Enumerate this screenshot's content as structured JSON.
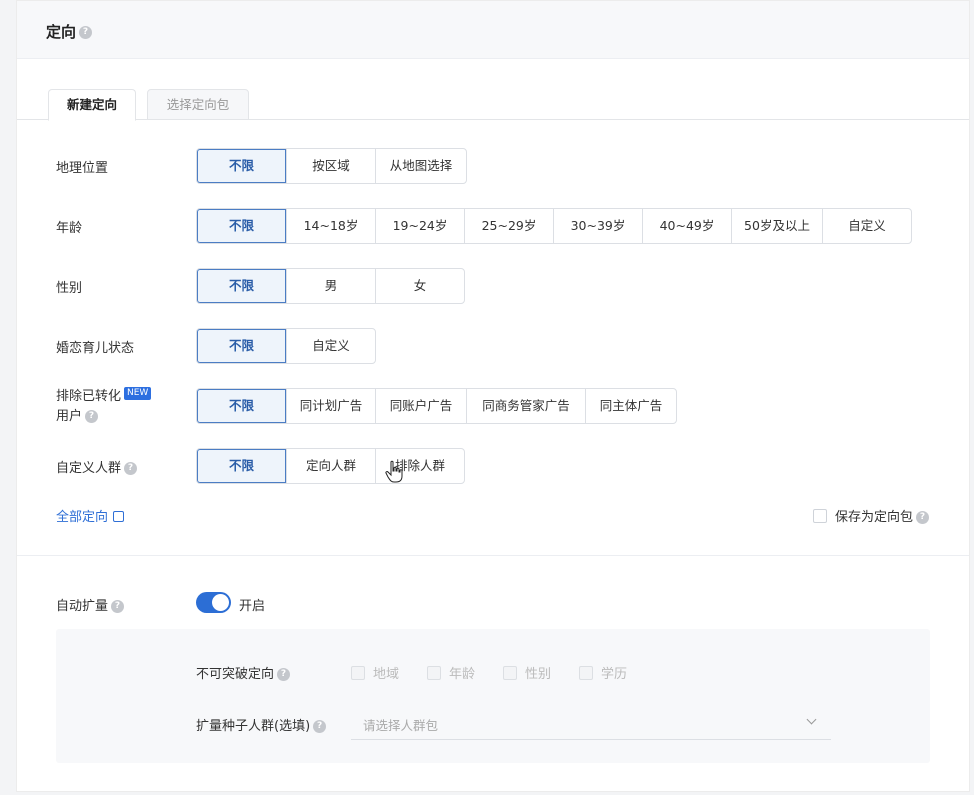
{
  "header": {
    "title": "定向"
  },
  "tabs": [
    {
      "label": "新建定向",
      "active": true
    },
    {
      "label": "选择定向包",
      "active": false
    }
  ],
  "rows": [
    {
      "label": "地理位置",
      "options": [
        "不限",
        "按区域",
        "从地图选择"
      ],
      "selected": 0
    },
    {
      "label": "年龄",
      "options": [
        "不限",
        "14~18岁",
        "19~24岁",
        "25~29岁",
        "30~39岁",
        "40~49岁",
        "50岁及以上",
        "自定义"
      ],
      "selected": 0
    },
    {
      "label": "性别",
      "options": [
        "不限",
        "男",
        "女"
      ],
      "selected": 0
    },
    {
      "label": "婚恋育儿状态",
      "options": [
        "不限",
        "自定义"
      ],
      "selected": 0
    },
    {
      "label_line1": "排除已转化",
      "badge": "NEW",
      "label_line2": "用户",
      "options": [
        "不限",
        "同计划广告",
        "同账户广告",
        "同商务管家广告",
        "同主体广告"
      ],
      "selected": 0
    },
    {
      "label": "自定义人群",
      "options": [
        "不限",
        "定向人群",
        "排除人群"
      ],
      "selected": 0
    }
  ],
  "all_targeting_link": "全部定向",
  "save_as_package": "保存为定向包",
  "auto_expand": {
    "label": "自动扩量",
    "enabled": true,
    "switch_text": "开启",
    "unbreakable_label": "不可突破定向",
    "unbreakable_options": [
      "地域",
      "年龄",
      "性别",
      "学历"
    ],
    "seed_label": "扩量种子人群(选填)",
    "seed_placeholder": "请选择人群包"
  },
  "colors": {
    "accent": "#2c6ed5",
    "selected_text": "#2a5da8",
    "link": "#2f6fd6"
  }
}
